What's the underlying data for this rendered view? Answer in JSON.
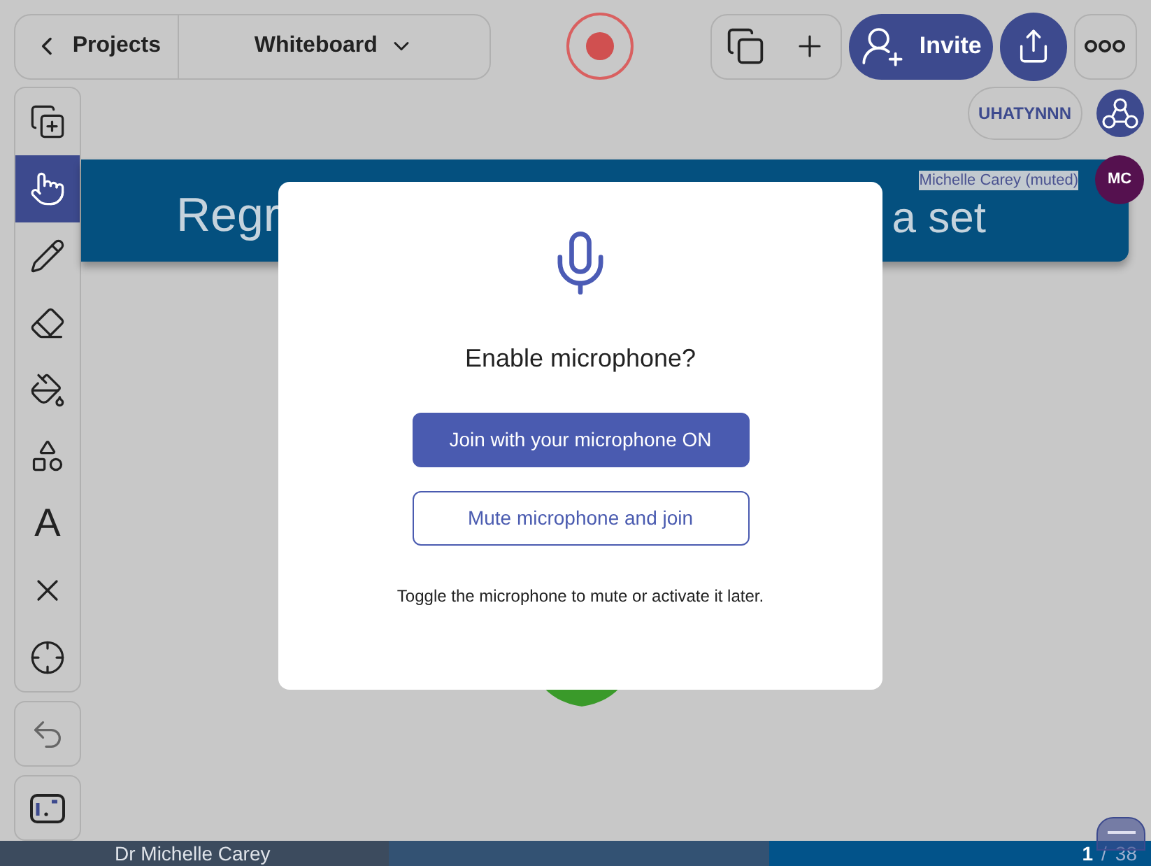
{
  "top_bar": {
    "back_label": "Projects",
    "board_title": "Whiteboard",
    "recording": true,
    "invite_label": "Invite"
  },
  "room": {
    "code": "UHATYNNN"
  },
  "presenter": {
    "name": "Michelle Carey (muted)",
    "initials": "MC"
  },
  "slide": {
    "title_left": "Regr",
    "title_right": "a set"
  },
  "tools": [
    {
      "kind": "copy-plus",
      "selected": false
    },
    {
      "kind": "hand",
      "selected": true
    },
    {
      "kind": "pencil",
      "selected": false
    },
    {
      "kind": "eraser",
      "selected": false
    },
    {
      "kind": "bucket",
      "selected": false
    },
    {
      "kind": "shapes",
      "selected": false
    },
    {
      "kind": "text",
      "label": "A",
      "selected": false
    },
    {
      "kind": "x",
      "selected": false
    },
    {
      "kind": "target",
      "selected": false
    }
  ],
  "dialog": {
    "title": "Enable microphone?",
    "primary": "Join with your microphone ON",
    "secondary": "Mute microphone and join",
    "hint": "Toggle the microphone to mute or activate it later."
  },
  "footer": {
    "speaker": "Dr Michelle Carey",
    "page": "1",
    "separator": "/",
    "total": "38"
  }
}
